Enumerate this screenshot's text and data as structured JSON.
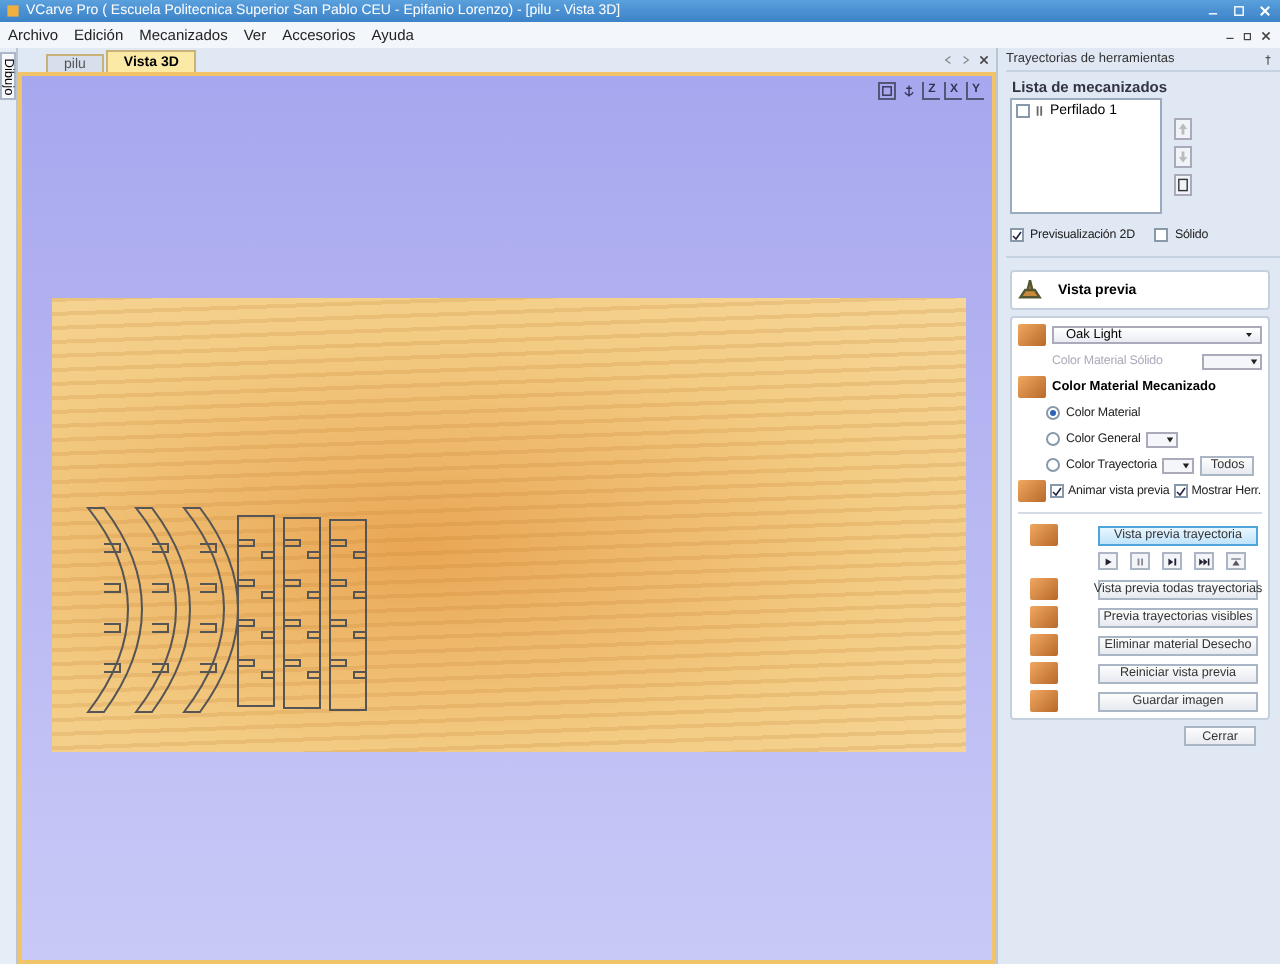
{
  "window": {
    "title": "VCarve Pro ( Escuela Politecnica Superior San Pablo CEU - Epifanio Lorenzo) - [pilu - Vista 3D]"
  },
  "menu": [
    "Archivo",
    "Edición",
    "Mecanizados",
    "Ver",
    "Accesorios",
    "Ayuda"
  ],
  "side_tab": {
    "label": "Dibujo"
  },
  "document_tabs": [
    {
      "label": "pilu",
      "selected": false
    },
    {
      "label": "Vista 3D",
      "selected": true
    }
  ],
  "view_buttons": [
    {
      "kind": "frame"
    },
    {
      "kind": "anchor"
    },
    {
      "kind": "axis",
      "label": "Z"
    },
    {
      "kind": "axis",
      "label": "X"
    },
    {
      "kind": "axis",
      "label": "Y"
    }
  ],
  "toolpath_panel": {
    "title": "Trayectorias de herramientas",
    "list_heading": "Lista de mecanizados",
    "toolpaths": [
      {
        "name": "Perfilado 1",
        "checked": false
      }
    ],
    "options": [
      {
        "label": "Previsualización 2D",
        "checked": true
      },
      {
        "label": "Sólido",
        "checked": false
      }
    ],
    "preview_title": "Vista previa",
    "material": {
      "value": "Oak Light"
    },
    "solid_color": {
      "label": "Color Material Sólido",
      "disabled": true
    },
    "machined_heading": "Color Material Mecanizado",
    "color_modes": [
      {
        "label": "Color Material",
        "selected": true
      },
      {
        "label": "Color General",
        "selected": false
      },
      {
        "label": "Color Trayectoria",
        "selected": false
      }
    ],
    "all_button": "Todos",
    "animate": {
      "label": "Animar vista previa",
      "checked": true
    },
    "show_tool": {
      "label": "Mostrar Herr.",
      "checked": true
    },
    "preview_button": "Vista previa trayectoria",
    "playback": [
      {
        "kind": "play"
      },
      {
        "kind": "pause"
      },
      {
        "kind": "step"
      },
      {
        "kind": "end"
      },
      {
        "kind": "reset"
      }
    ],
    "actions": [
      "Vista previa todas trayectorias",
      "Previa trayectorias visibles",
      "Eliminar material Desecho",
      "Reiniciar vista previa",
      "Guardar imagen"
    ],
    "close_button": "Cerrar"
  }
}
